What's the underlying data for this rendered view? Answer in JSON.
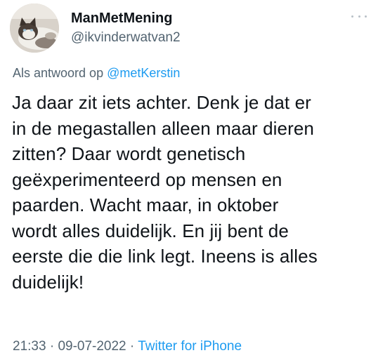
{
  "author": {
    "display_name": "ManMetMening",
    "handle": "@ikvinderwatvan2",
    "avatar_icon": "cat-avatar"
  },
  "reply": {
    "prefix": "Als antwoord op",
    "mention": "@metKerstin"
  },
  "tweet": {
    "lines": [
      "Ja daar zit iets achter. Denk je dat er",
      "in de megastallen alleen maar dieren",
      "zitten? Daar wordt genetisch",
      "geëxperimenteerd op mensen en",
      "paarden. Wacht maar, in oktober",
      "wordt alles duidelijk. En jij bent de",
      "eerste die die link legt. Ineens is alles",
      "duidelijk!"
    ]
  },
  "meta": {
    "time": "21:33",
    "sep1": "·",
    "date": "09-07-2022",
    "sep2": "·",
    "source": "Twitter for iPhone"
  },
  "colors": {
    "text": "#0f1419",
    "secondary": "#536471",
    "link": "#1d9bf0"
  }
}
